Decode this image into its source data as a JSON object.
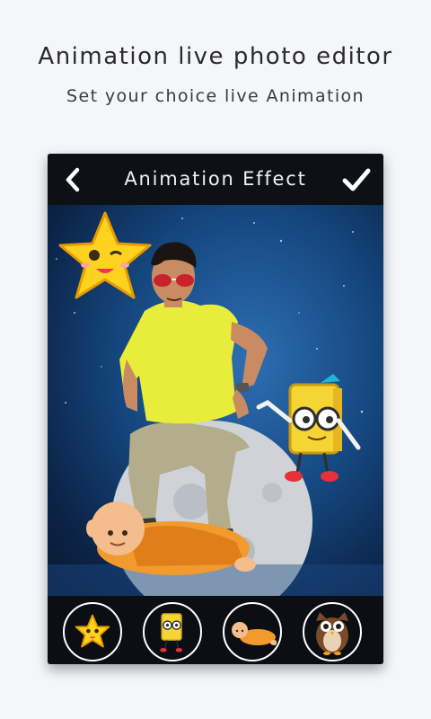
{
  "header": {
    "title": "Animation live photo editor",
    "subtitle": "Set your choice live Animation"
  },
  "editor": {
    "title": "Animation Effect",
    "back_icon": "chevron-left-icon",
    "confirm_icon": "checkmark-icon"
  },
  "stickers": [
    {
      "name": "star",
      "icon": "star-sticker-icon"
    },
    {
      "name": "book",
      "icon": "book-sticker-icon"
    },
    {
      "name": "monk",
      "icon": "monk-sticker-icon"
    },
    {
      "name": "owl",
      "icon": "owl-sticker-icon"
    }
  ],
  "colors": {
    "page_bg": "#f4f6fa",
    "frame_bg": "#0b0e12",
    "star": "#ffd21f",
    "book": "#f4d534",
    "robe": "#f29a2e",
    "shirt": "#e8ec3a",
    "sky": "#15477f"
  }
}
